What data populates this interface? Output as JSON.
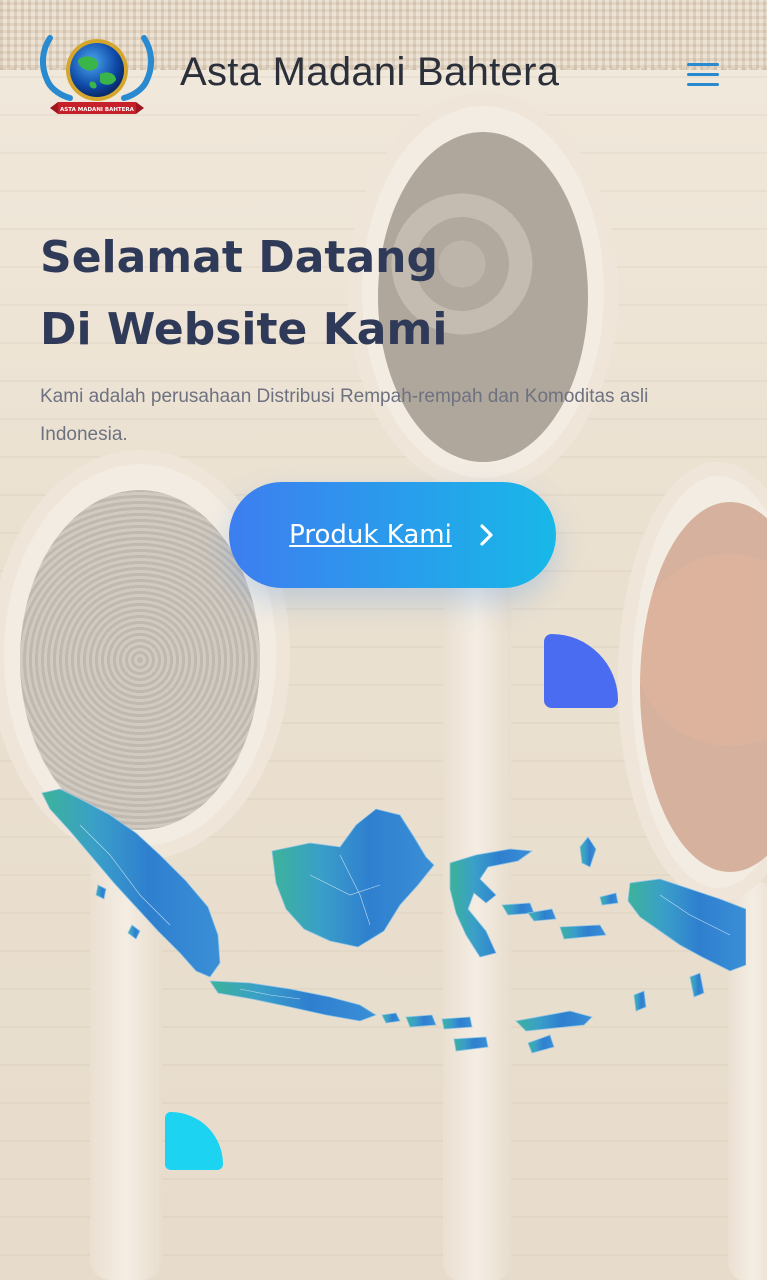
{
  "header": {
    "brand_name": "Asta Madani Bahtera",
    "logo_banner_text": "ASTA MADANI BAHTERA",
    "menu_icon": "hamburger-menu-icon"
  },
  "hero": {
    "title_line1": "Selamat Datang",
    "title_line2": "Di Website Kami",
    "description": "Kami adalah perusahaan Distribusi Rempah-rempah dan Komoditas asli Indonesia.",
    "cta_label": "Produk Kami",
    "cta_icon": "chevron-right-icon"
  },
  "decor": {
    "map": "indonesia-map-illustration",
    "background": "spice-spoons-photo"
  },
  "colors": {
    "title": "#2f3a58",
    "text": "#6e7280",
    "cta_start": "#3d7ef0",
    "cta_end": "#18b8e8",
    "blob_blue": "#4a6cf0",
    "blob_cyan": "#1dd3f2",
    "menu": "#2a8ad0"
  }
}
